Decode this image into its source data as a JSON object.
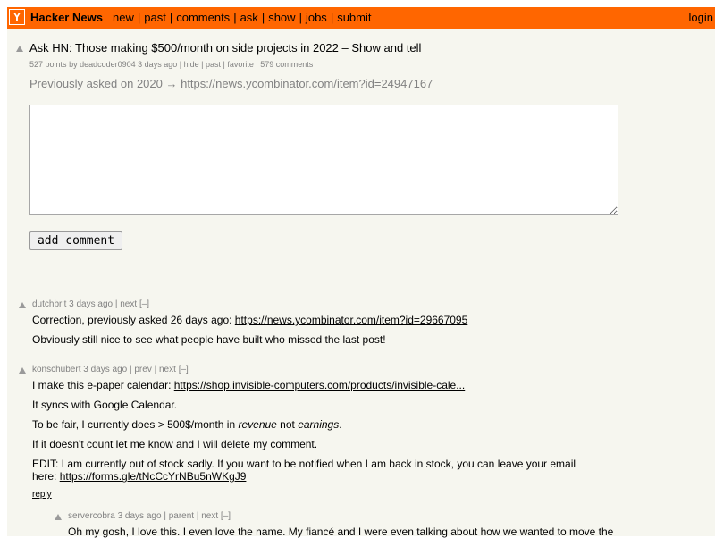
{
  "header": {
    "logo": "Y",
    "site_name": "Hacker News",
    "nav": [
      "new",
      "past",
      "comments",
      "ask",
      "show",
      "jobs",
      "submit"
    ],
    "login": "login",
    "accent_color": "#ff6600"
  },
  "story": {
    "title": "Ask HN: Those making $500/month on side projects in 2022 – Show and tell",
    "points": "527 points",
    "by": "by",
    "author": "deadcoder0904",
    "age": "3 days ago",
    "hide": "hide",
    "past": "past",
    "favorite": "favorite",
    "comments": "579 comments",
    "previously": "Previously asked on 2020 → https://news.ycombinator.com/item?id=24947167"
  },
  "reply_form": {
    "value": "",
    "button": "add comment"
  },
  "comments": [
    {
      "author": "dutchbrit",
      "age": "3 days ago",
      "links": [
        "next",
        "[–]"
      ],
      "paragraphs": [
        {
          "text": "Correction, previously asked 26 days ago: ",
          "link": "https://news.ycombinator.com/item?id=29667095"
        },
        {
          "text": "Obviously still nice to see what people have built who missed the last post!"
        }
      ]
    },
    {
      "author": "konschubert",
      "age": "3 days ago",
      "links": [
        "prev",
        "next",
        "[–]"
      ],
      "paragraphs": [
        {
          "text": "I make this e-paper calendar: ",
          "link": "https://shop.invisible-computers.com/products/invisible-cale..."
        },
        {
          "text": "It syncs with Google Calendar."
        },
        {
          "text_a": "To be fair, I currently does > 500$/month in ",
          "em_a": "revenue",
          "text_b": " not ",
          "em_b": "earnings",
          "text_c": "."
        },
        {
          "text": "If it doesn't count let me know and I will delete my comment."
        },
        {
          "text": "EDIT: I am currently out of stock sadly. If you want to be notified when I am back in stock, you can leave your email here: ",
          "link": "https://forms.gle/tNcCcYrNBu5nWKgJ9"
        }
      ],
      "reply": "reply"
    },
    {
      "author": "servercobra",
      "age": "3 days ago",
      "links": [
        "parent",
        "next",
        "[–]"
      ],
      "paragraphs": [
        {
          "text": "Oh my gosh, I love this. I even love the name. My fiancé and I were even talking about how we wanted to move the"
        }
      ]
    }
  ]
}
